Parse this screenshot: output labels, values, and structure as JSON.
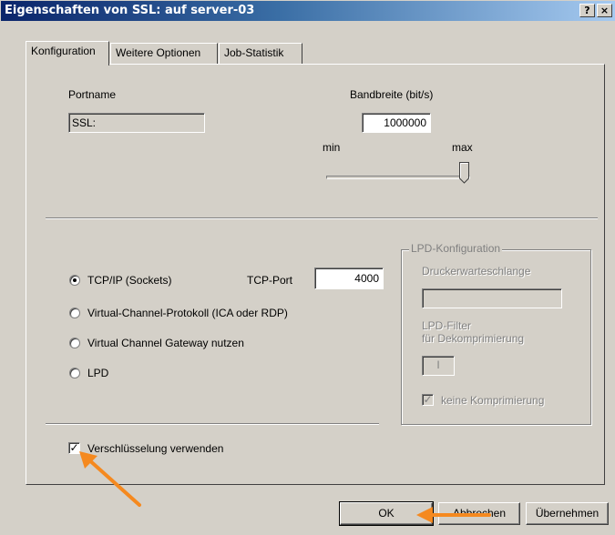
{
  "window": {
    "title": "Eigenschaften von SSL: auf server-03",
    "help_btn": "?",
    "close_btn": "×"
  },
  "tabs": [
    {
      "label": "Konfiguration",
      "active": true
    },
    {
      "label": "Weitere Optionen",
      "active": false
    },
    {
      "label": "Job-Statistik",
      "active": false
    }
  ],
  "portname": {
    "label": "Portname",
    "value": "SSL:"
  },
  "bandwidth": {
    "label": "Bandbreite (bit/s)",
    "value": "1000000",
    "min_label": "min",
    "max_label": "max",
    "slider_level": 1.0
  },
  "protocols": {
    "tcpip": {
      "label": "TCP/IP (Sockets)",
      "selected": true
    },
    "tcp_port_label": "TCP-Port",
    "tcp_port_value": "4000",
    "vcp": {
      "label": "Virtual-Channel-Protokoll (ICA oder RDP)",
      "selected": false
    },
    "vcg": {
      "label": "Virtual Channel Gateway nutzen",
      "selected": false
    },
    "lpd": {
      "label": "LPD",
      "selected": false
    }
  },
  "lpd_config": {
    "group_label": "LPD-Konfiguration",
    "queue_label": "Druckerwarteschlange",
    "queue_value": "",
    "filter_label_1": "LPD-Filter",
    "filter_label_2": "für Dekomprimierung",
    "filter_value": "I",
    "no_compression_label": "keine Komprimierung",
    "no_compression_checked": true
  },
  "encryption": {
    "label": "Verschlüsselung verwenden",
    "checked": true
  },
  "buttons": {
    "ok": "OK",
    "cancel": "Abbrechen",
    "apply": "Übernehmen"
  },
  "colors": {
    "title_start": "#0a246a",
    "title_end": "#a6caf0",
    "face": "#d4d0c8",
    "annotation_arrow": "#f5891f"
  }
}
